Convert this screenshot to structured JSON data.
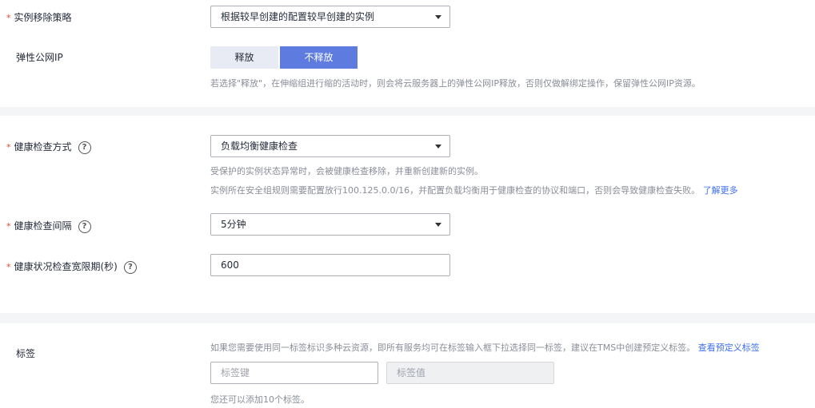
{
  "colors": {
    "accent": "#5e7ce0",
    "required": "#e2472f",
    "link": "#3f6ff1"
  },
  "instance_removal": {
    "required_mark": "*",
    "label": "实例移除策略",
    "selected": "根据较早创建的配置较早创建的实例"
  },
  "elastic_ip": {
    "label": "弹性公网IP",
    "options": [
      "释放",
      "不释放"
    ],
    "selected": "不释放",
    "hint": "若选择\"释放\"，在伸缩组进行缩的活动时，则会将云服务器上的弹性公网IP释放，否则仅做解绑定操作，保留弹性公网IP资源。"
  },
  "health_check_mode": {
    "required_mark": "*",
    "label": "健康检查方式",
    "help_icon": "?",
    "selected": "负载均衡健康检查",
    "hint1": "受保护的实例状态异常时，会被健康检查移除，并重新创建新的实例。",
    "hint2": "实例所在安全组规则需要配置放行100.125.0.0/16，并配置负载均衡用于健康检查的协议和端口，否则会导致健康检查失败。",
    "learn_more": "了解更多"
  },
  "health_check_interval": {
    "required_mark": "*",
    "label": "健康检查间隔",
    "help_icon": "?",
    "selected": "5分钟"
  },
  "grace_period": {
    "required_mark": "*",
    "label": "健康状况检查宽限期(秒)",
    "help_icon": "?",
    "value": "600"
  },
  "tags": {
    "label": "标签",
    "hint": "如果您需要使用同一标签标识多种云资源，即所有服务均可在标签输入框下拉选择同一标签，建议在TMS中创建预定义标签。",
    "view_link": "查看预定义标签",
    "key_placeholder": "标签键",
    "value_placeholder": "标签值",
    "remaining": "您还可以添加10个标签。"
  }
}
